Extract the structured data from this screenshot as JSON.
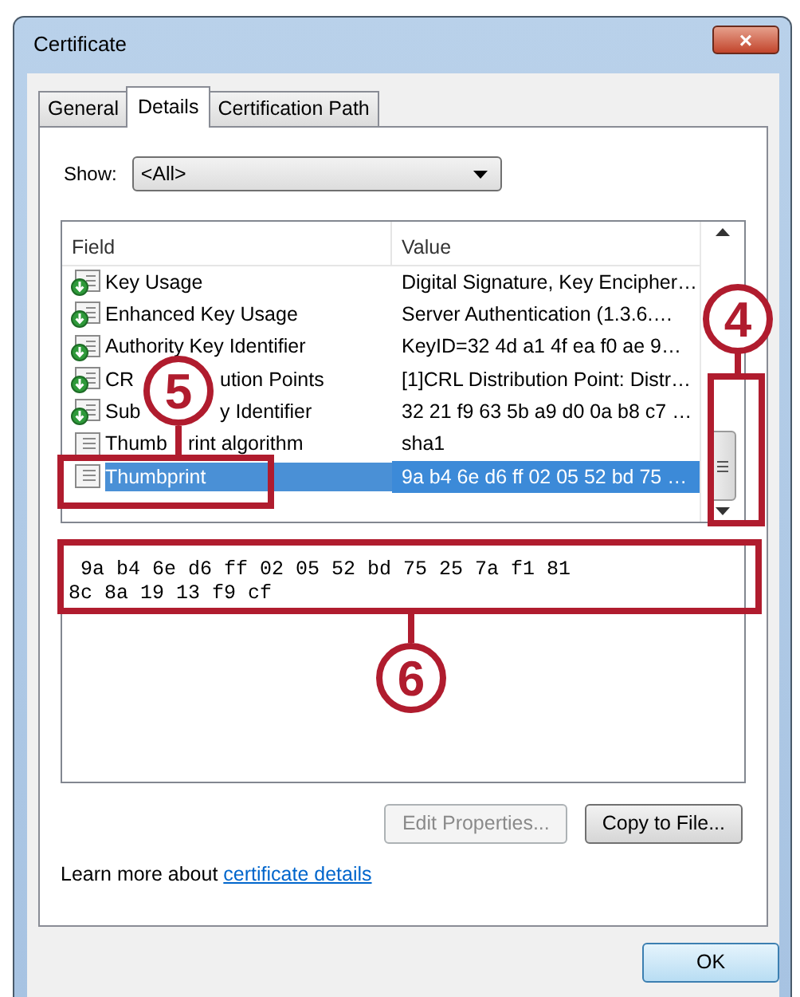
{
  "window": {
    "title": "Certificate",
    "close": "×"
  },
  "tabs": [
    {
      "label": "General",
      "selected": false
    },
    {
      "label": "Details",
      "selected": true
    },
    {
      "label": "Certification Path",
      "selected": false
    }
  ],
  "show": {
    "label": "Show:",
    "value": "<All>"
  },
  "list": {
    "columns": [
      "Field",
      "Value"
    ],
    "rows": [
      {
        "kind": "extension",
        "field": "Key Usage",
        "value": "Digital Signature, Key Encipher…",
        "selected": false
      },
      {
        "kind": "extension",
        "field": "Enhanced Key Usage",
        "value": "Server Authentication (1.3.6.…",
        "selected": false
      },
      {
        "kind": "extension",
        "field": "Authority Key Identifier",
        "value": "KeyID=32 4d a1 4f ea f0 ae 9…",
        "selected": false
      },
      {
        "kind": "extension",
        "field": [
          "CR",
          "ution Points"
        ],
        "value": "[1]CRL Distribution Point: Distr…",
        "selected": false
      },
      {
        "kind": "extension",
        "field": [
          "Sub",
          "y Identifier"
        ],
        "value": "32 21 f9 63 5b a9 d0 0a b8 c7 …",
        "selected": false
      },
      {
        "kind": "property",
        "field": [
          "Thumb",
          "rint algorithm"
        ],
        "value": "sha1",
        "selected": false
      },
      {
        "kind": "property",
        "field": "Thumbprint",
        "value": "9a b4 6e d6 ff 02 05 52 bd 75 …",
        "selected": true
      }
    ]
  },
  "detail_text": " 9a b4 6e d6 ff 02 05 52 bd 75 25 7a f1 81\n8c 8a 19 13 f9 cf",
  "buttons": [
    {
      "label": "Edit Properties...",
      "disabled": true
    },
    {
      "label": "Copy to File...",
      "disabled": false
    }
  ],
  "learn_more": {
    "text": "Learn more about ",
    "link": "certificate details"
  },
  "ok_button": "OK",
  "callouts": [
    {
      "label": "4"
    },
    {
      "label": "5"
    },
    {
      "label": "6"
    }
  ]
}
